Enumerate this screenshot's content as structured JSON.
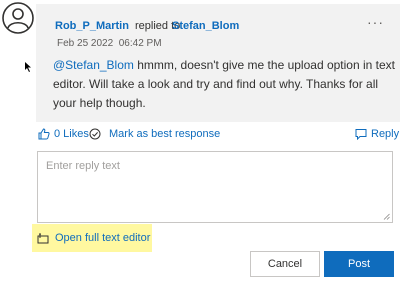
{
  "post": {
    "author": "Rob_P_Martin",
    "replied_to_text": "replied to",
    "replied_to_user": "Stefan_Blom",
    "date": "Feb 25 2022",
    "time": "06:42 PM",
    "mention": "@Stefan_Blom",
    "body": " hmmm, doesn't give me the upload option in text editor. Will take a look and try and find out why. Thanks for all your help though."
  },
  "actions": {
    "likes_label": "0 Likes",
    "best_response_label": "Mark as best response",
    "reply_label": "Reply"
  },
  "reply_box": {
    "placeholder": "Enter reply text",
    "value": ""
  },
  "editor_link": "Open full text editor",
  "buttons": {
    "cancel": "Cancel",
    "post": "Post"
  },
  "icons": {
    "avatar": "user-avatar-icon",
    "more": "more-options-icon",
    "like": "thumbs-up-icon",
    "best_response": "check-circle-icon",
    "reply": "reply-speech-icon",
    "editor": "text-editor-icon"
  },
  "colors": {
    "link": "#0f6cbd",
    "post_button": "#0f6cbd",
    "highlight": "#fff8a0",
    "bubble": "#f2f2f2"
  }
}
